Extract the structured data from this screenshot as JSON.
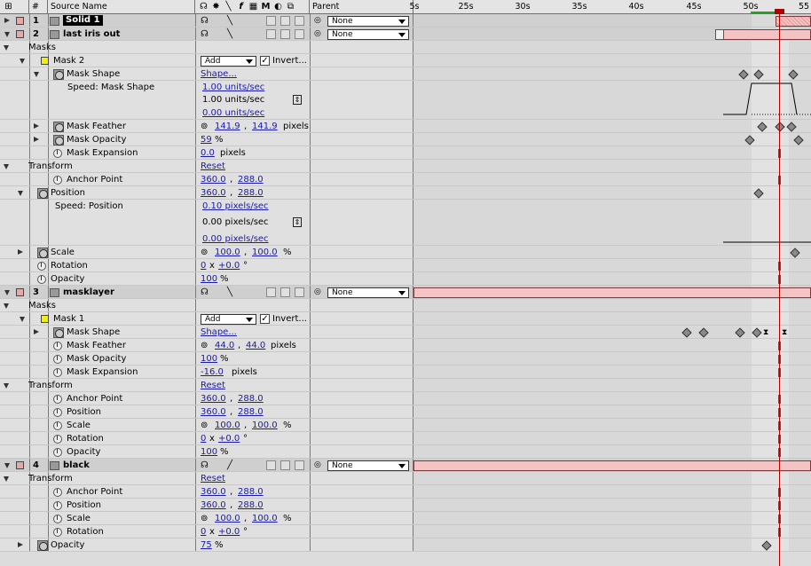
{
  "header": {
    "num": "#",
    "source_name": "Source Name",
    "parent": "Parent",
    "switch_icons": [
      "shy-icon",
      "collapse-icon",
      "quality-icon",
      "effect-icon",
      "frame-blend-icon",
      "motion-blur-icon",
      "adjustment-icon",
      "3d-icon"
    ],
    "ticks": [
      "5s",
      "25s",
      "30s",
      "35s",
      "40s",
      "45s",
      "50s",
      "55"
    ]
  },
  "layers": [
    {
      "num": "1",
      "name": "Solid 1",
      "color": "#e8a8a8",
      "parent": "None"
    },
    {
      "num": "2",
      "name": "last iris out",
      "color": "#e8a8a8",
      "parent": "None"
    },
    {
      "num": "3",
      "name": "masklayer",
      "color": "#e8a8a8",
      "parent": "None"
    },
    {
      "num": "4",
      "name": "black",
      "color": "#e8a8a8",
      "parent": "None"
    }
  ],
  "groups": {
    "masks": "Masks",
    "transform": "Transform",
    "mask2": "Mask 2",
    "mask1": "Mask 1"
  },
  "mask_mode": "Add",
  "invert_label": "Invert...",
  "props": {
    "mask_shape": "Mask Shape",
    "speed_mask_shape": "Speed: Mask Shape",
    "mask_feather": "Mask Feather",
    "mask_opacity": "Mask Opacity",
    "mask_expansion": "Mask Expansion",
    "anchor_point": "Anchor Point",
    "position": "Position",
    "speed_position": "Speed: Position",
    "scale": "Scale",
    "rotation": "Rotation",
    "opacity": "Opacity"
  },
  "values": {
    "shape": "Shape...",
    "reset": "Reset",
    "speed_top": "1.00 units/sec",
    "speed_mid": "1.00 units/sec",
    "speed_bot": "0.00 units/sec",
    "l2_feather_x": "141.9",
    "l2_feather_y": "141.9",
    "pixels": "pixels",
    "l2_mask_opacity": "59",
    "pct": "%",
    "l2_expansion": "0.0",
    "xy_360": "360.0",
    "xy_288": "288.0",
    "pos_speed_top": "0.10 pixels/sec",
    "pos_speed_mid": "0.00 pixels/sec",
    "pos_speed_bot": "0.00 pixels/sec",
    "scale_100": "100.0",
    "rot_turns": "0",
    "rot_x": "x",
    "rot_deg": "+0.0",
    "deg": "°",
    "opacity_100": "100",
    "l3_feather": "44.0",
    "l3_mask_opacity": "100",
    "l3_expansion": "-16.0",
    "l4_opacity": "75"
  },
  "colors": {
    "accent_keyframe": "#8a8a8a",
    "layer_bar": "#f4c3c3",
    "time_indicator": "#b00000",
    "work_area": "#28a028",
    "mask_yellow": "#f0f000"
  }
}
